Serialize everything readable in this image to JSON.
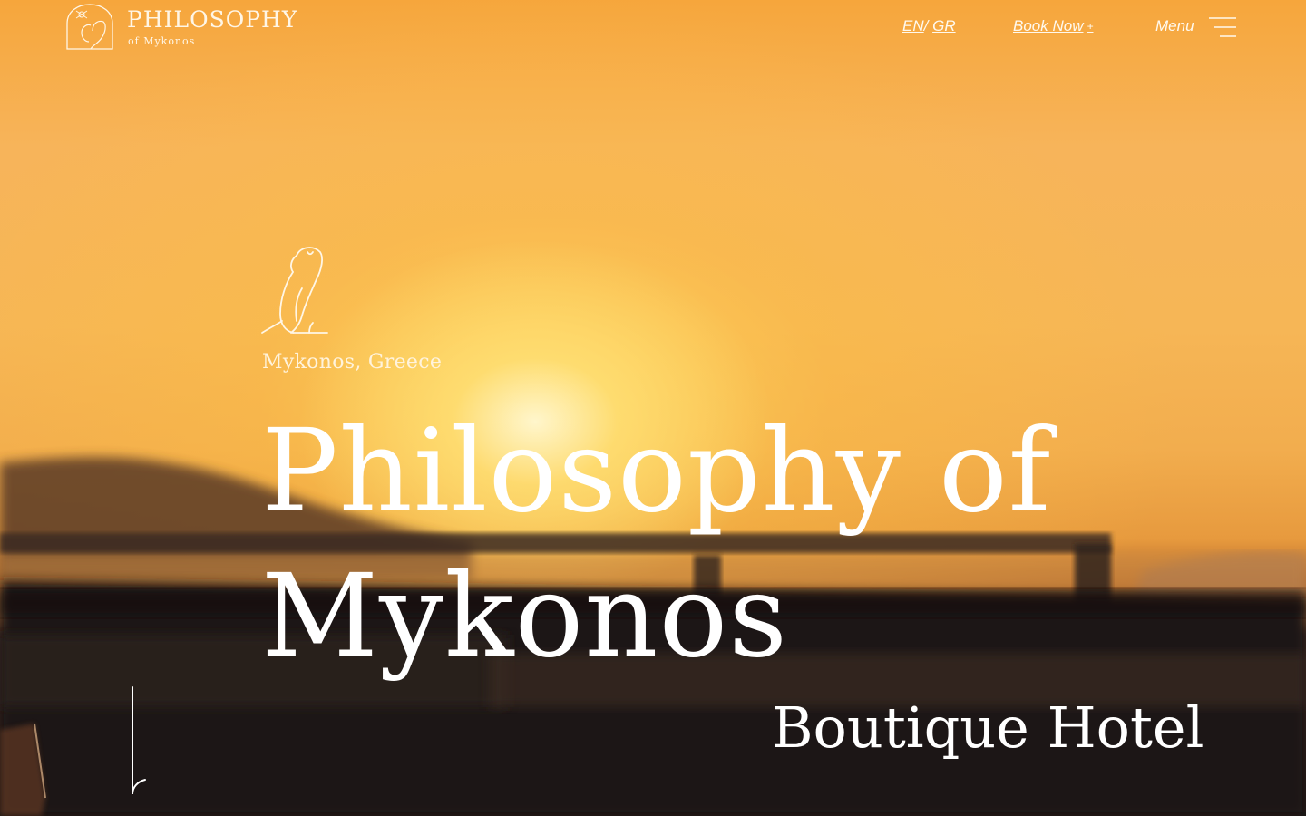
{
  "header": {
    "logo": {
      "title": "PHILOSOPHY",
      "subtitle": "of Mykonos",
      "icon": "owl-arch-logo-icon"
    },
    "language": {
      "current": "EN",
      "separator": "/",
      "alternate": "GR"
    },
    "book_now": {
      "label": "Book Now",
      "suffix": "+"
    },
    "menu": {
      "label": "Menu",
      "icon": "hamburger-menu-icon"
    }
  },
  "hero": {
    "emblem_icon": "owl-icon",
    "location": "Mykonos, Greece",
    "title_line1": "Philosophy of",
    "title_line2": "Mykonos",
    "subtitle": "Boutique Hotel",
    "scroll_icon": "scroll-down-line-icon"
  },
  "colors": {
    "sky_top": "#f6a63c",
    "sun_glow": "#fff8d2",
    "foreground_dark": "#1c1612",
    "text": "#ffffff"
  }
}
